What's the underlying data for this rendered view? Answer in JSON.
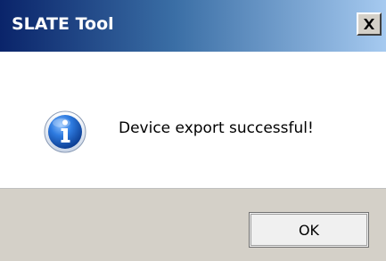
{
  "window": {
    "title": "SLATE Tool",
    "close_symbol": "×"
  },
  "dialog": {
    "icon": "info-icon",
    "message": "Device export successful!"
  },
  "buttons": {
    "ok_label": "OK"
  },
  "colors": {
    "titlebar_start": "#0a246a",
    "titlebar_end": "#a6caf0",
    "footer_bg": "#d4d0c8",
    "icon_blue": "#1c5fb8"
  }
}
